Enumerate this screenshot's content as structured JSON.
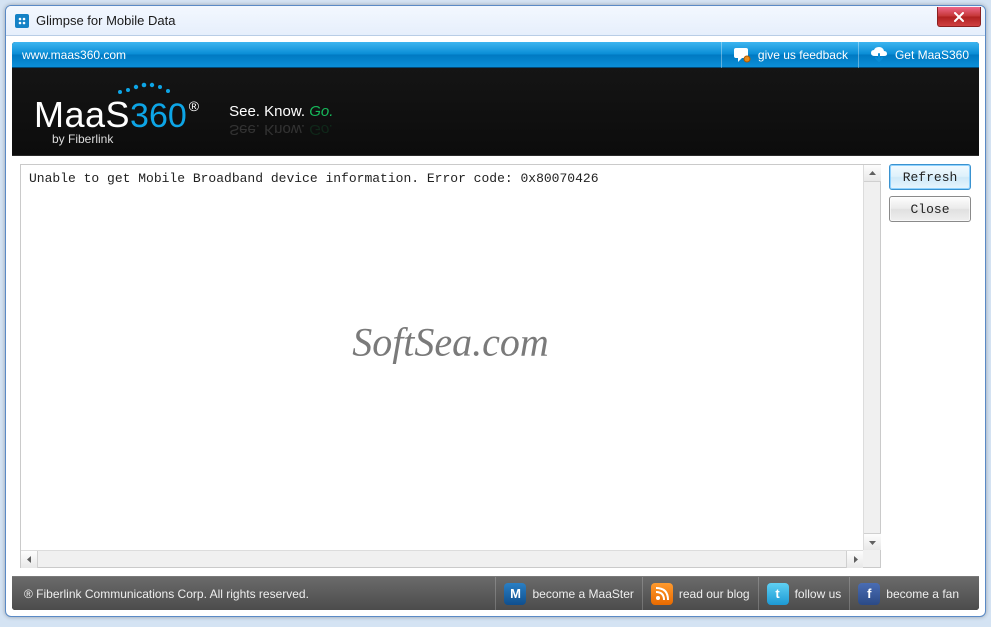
{
  "titlebar": {
    "title": "Glimpse for Mobile Data"
  },
  "topbar": {
    "url": "www.maas360.com",
    "feedback": "give us feedback",
    "get": "Get MaaS360"
  },
  "brand": {
    "logo_part1": "MaaS",
    "logo_part2": "360",
    "byline": "by Fiberlink",
    "tagline_see": "See.",
    "tagline_know": "Know.",
    "tagline_go": "Go."
  },
  "content": {
    "error_text": "Unable to get Mobile Broadband device information. Error code: 0x80070426",
    "watermark": "SoftSea.com"
  },
  "buttons": {
    "refresh": "Refresh",
    "close": "Close"
  },
  "footer": {
    "copyright": "® Fiberlink Communications Corp. All rights reserved.",
    "maaster": "become a MaaSter",
    "blog": "read our blog",
    "follow": "follow us",
    "fan": "become a fan"
  }
}
